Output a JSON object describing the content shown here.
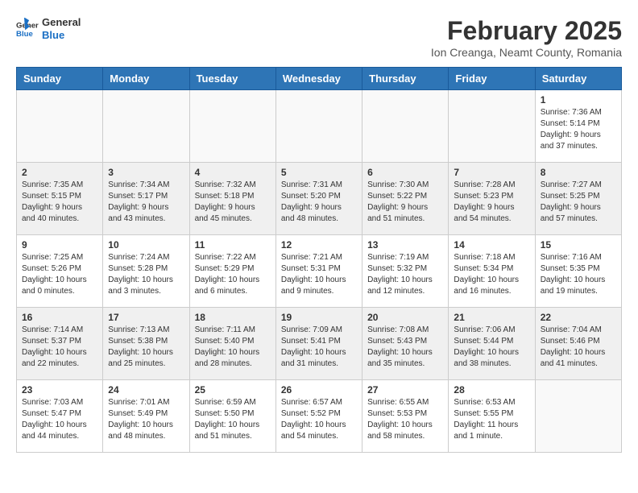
{
  "header": {
    "logo_general": "General",
    "logo_blue": "Blue",
    "month_year": "February 2025",
    "location": "Ion Creanga, Neamt County, Romania"
  },
  "days_of_week": [
    "Sunday",
    "Monday",
    "Tuesday",
    "Wednesday",
    "Thursday",
    "Friday",
    "Saturday"
  ],
  "weeks": [
    {
      "shaded": false,
      "days": [
        {
          "number": "",
          "info": ""
        },
        {
          "number": "",
          "info": ""
        },
        {
          "number": "",
          "info": ""
        },
        {
          "number": "",
          "info": ""
        },
        {
          "number": "",
          "info": ""
        },
        {
          "number": "",
          "info": ""
        },
        {
          "number": "1",
          "info": "Sunrise: 7:36 AM\nSunset: 5:14 PM\nDaylight: 9 hours and 37 minutes."
        }
      ]
    },
    {
      "shaded": true,
      "days": [
        {
          "number": "2",
          "info": "Sunrise: 7:35 AM\nSunset: 5:15 PM\nDaylight: 9 hours and 40 minutes."
        },
        {
          "number": "3",
          "info": "Sunrise: 7:34 AM\nSunset: 5:17 PM\nDaylight: 9 hours and 43 minutes."
        },
        {
          "number": "4",
          "info": "Sunrise: 7:32 AM\nSunset: 5:18 PM\nDaylight: 9 hours and 45 minutes."
        },
        {
          "number": "5",
          "info": "Sunrise: 7:31 AM\nSunset: 5:20 PM\nDaylight: 9 hours and 48 minutes."
        },
        {
          "number": "6",
          "info": "Sunrise: 7:30 AM\nSunset: 5:22 PM\nDaylight: 9 hours and 51 minutes."
        },
        {
          "number": "7",
          "info": "Sunrise: 7:28 AM\nSunset: 5:23 PM\nDaylight: 9 hours and 54 minutes."
        },
        {
          "number": "8",
          "info": "Sunrise: 7:27 AM\nSunset: 5:25 PM\nDaylight: 9 hours and 57 minutes."
        }
      ]
    },
    {
      "shaded": false,
      "days": [
        {
          "number": "9",
          "info": "Sunrise: 7:25 AM\nSunset: 5:26 PM\nDaylight: 10 hours and 0 minutes."
        },
        {
          "number": "10",
          "info": "Sunrise: 7:24 AM\nSunset: 5:28 PM\nDaylight: 10 hours and 3 minutes."
        },
        {
          "number": "11",
          "info": "Sunrise: 7:22 AM\nSunset: 5:29 PM\nDaylight: 10 hours and 6 minutes."
        },
        {
          "number": "12",
          "info": "Sunrise: 7:21 AM\nSunset: 5:31 PM\nDaylight: 10 hours and 9 minutes."
        },
        {
          "number": "13",
          "info": "Sunrise: 7:19 AM\nSunset: 5:32 PM\nDaylight: 10 hours and 12 minutes."
        },
        {
          "number": "14",
          "info": "Sunrise: 7:18 AM\nSunset: 5:34 PM\nDaylight: 10 hours and 16 minutes."
        },
        {
          "number": "15",
          "info": "Sunrise: 7:16 AM\nSunset: 5:35 PM\nDaylight: 10 hours and 19 minutes."
        }
      ]
    },
    {
      "shaded": true,
      "days": [
        {
          "number": "16",
          "info": "Sunrise: 7:14 AM\nSunset: 5:37 PM\nDaylight: 10 hours and 22 minutes."
        },
        {
          "number": "17",
          "info": "Sunrise: 7:13 AM\nSunset: 5:38 PM\nDaylight: 10 hours and 25 minutes."
        },
        {
          "number": "18",
          "info": "Sunrise: 7:11 AM\nSunset: 5:40 PM\nDaylight: 10 hours and 28 minutes."
        },
        {
          "number": "19",
          "info": "Sunrise: 7:09 AM\nSunset: 5:41 PM\nDaylight: 10 hours and 31 minutes."
        },
        {
          "number": "20",
          "info": "Sunrise: 7:08 AM\nSunset: 5:43 PM\nDaylight: 10 hours and 35 minutes."
        },
        {
          "number": "21",
          "info": "Sunrise: 7:06 AM\nSunset: 5:44 PM\nDaylight: 10 hours and 38 minutes."
        },
        {
          "number": "22",
          "info": "Sunrise: 7:04 AM\nSunset: 5:46 PM\nDaylight: 10 hours and 41 minutes."
        }
      ]
    },
    {
      "shaded": false,
      "days": [
        {
          "number": "23",
          "info": "Sunrise: 7:03 AM\nSunset: 5:47 PM\nDaylight: 10 hours and 44 minutes."
        },
        {
          "number": "24",
          "info": "Sunrise: 7:01 AM\nSunset: 5:49 PM\nDaylight: 10 hours and 48 minutes."
        },
        {
          "number": "25",
          "info": "Sunrise: 6:59 AM\nSunset: 5:50 PM\nDaylight: 10 hours and 51 minutes."
        },
        {
          "number": "26",
          "info": "Sunrise: 6:57 AM\nSunset: 5:52 PM\nDaylight: 10 hours and 54 minutes."
        },
        {
          "number": "27",
          "info": "Sunrise: 6:55 AM\nSunset: 5:53 PM\nDaylight: 10 hours and 58 minutes."
        },
        {
          "number": "28",
          "info": "Sunrise: 6:53 AM\nSunset: 5:55 PM\nDaylight: 11 hours and 1 minute."
        },
        {
          "number": "",
          "info": ""
        }
      ]
    }
  ]
}
